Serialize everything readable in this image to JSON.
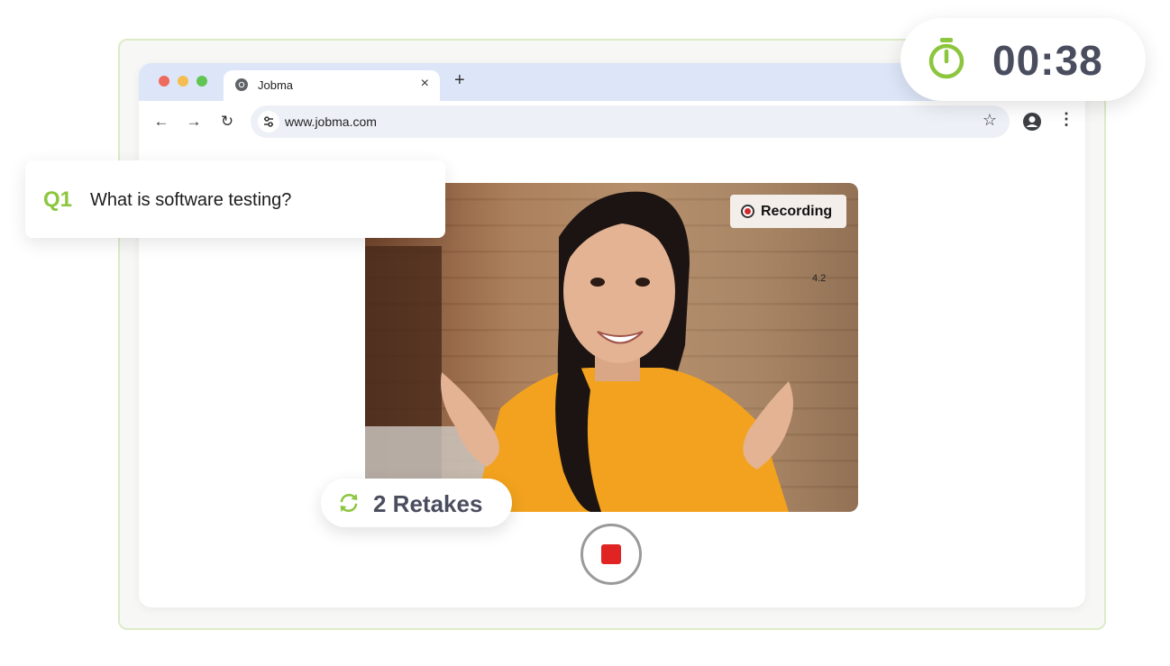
{
  "browser": {
    "tab_title": "Jobma",
    "new_tab_label": "+",
    "close_tab_label": "×",
    "url": "www.jobma.com",
    "back_label": "←",
    "forward_label": "→",
    "reload_label": "↻",
    "bookmark_label": "☆",
    "menu_label": "⋮"
  },
  "question": {
    "number": "Q1",
    "text": "What is software testing?"
  },
  "video": {
    "recording_label": "Recording",
    "overlay_value": "4.2"
  },
  "retakes": {
    "label": "2 Retakes",
    "icon": "refresh-icon"
  },
  "timer": {
    "value": "00:38",
    "icon": "stopwatch-icon"
  },
  "colors": {
    "accent_green": "#8cc63f",
    "record_red": "#e02424",
    "text_dark": "#4a4d5e"
  }
}
